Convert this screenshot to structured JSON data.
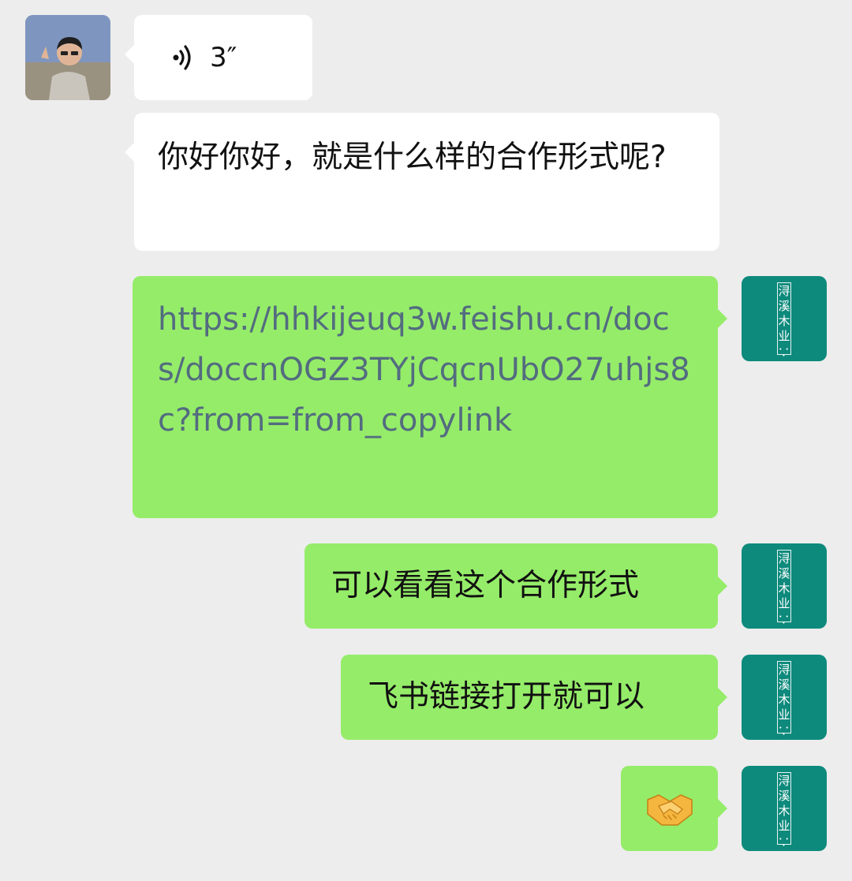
{
  "sender": {
    "avatar_icon": "person-photo-avatar"
  },
  "self": {
    "avatar_text": "浔溪木业",
    "avatar_color": "#0d8a7c"
  },
  "messages": {
    "voice": {
      "duration": "3″",
      "icon": "voice-wave-icon"
    },
    "question": {
      "text": "你好你好，就是什么样的合作形式呢?"
    },
    "link": {
      "text": "https://hhkijeuq3w.feishu.cn/docs/doccnOGZ3TYjCqcnUbO27uhjs8c?from=from_copylink"
    },
    "reply1": {
      "text": "可以看看这个合作形式"
    },
    "reply2": {
      "text": "飞书链接打开就可以"
    },
    "reply3": {
      "emoji": "handshake-emoji"
    }
  },
  "colors": {
    "background": "#ededed",
    "incoming_bubble": "#ffffff",
    "outgoing_bubble": "#95ec69",
    "link": "#536c7f"
  }
}
